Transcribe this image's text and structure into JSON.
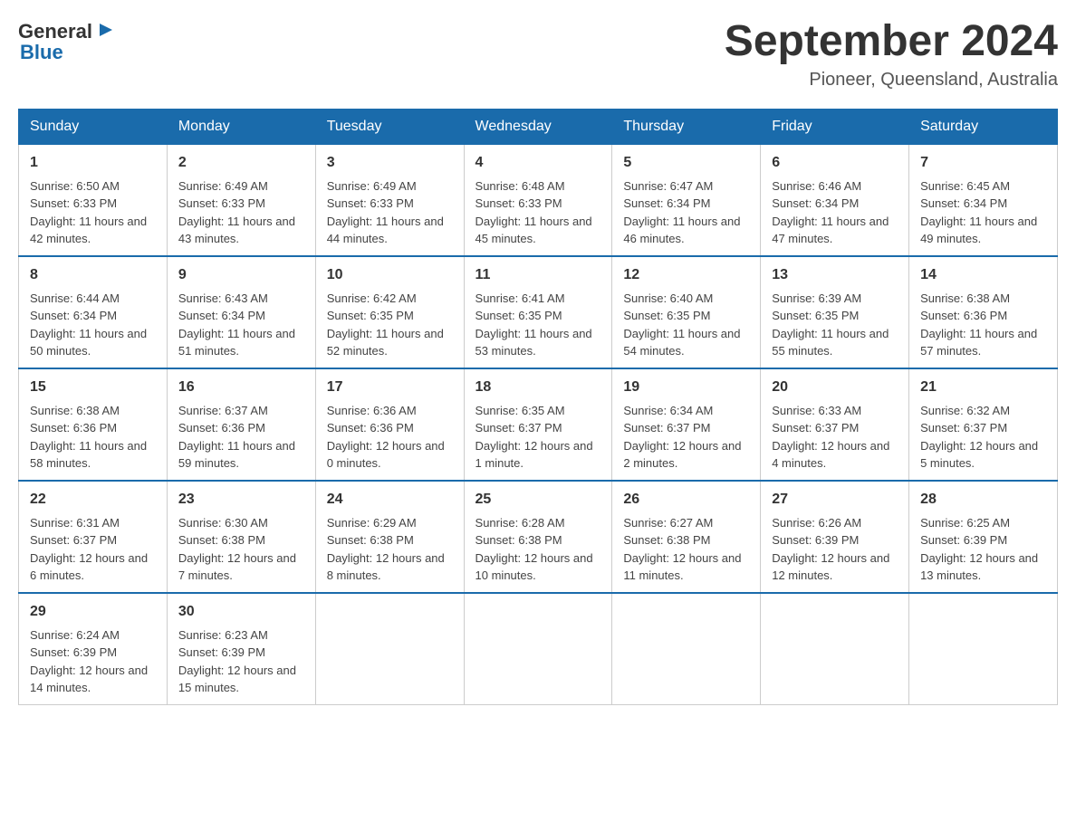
{
  "logo": {
    "general": "General",
    "blue": "Blue"
  },
  "title": "September 2024",
  "subtitle": "Pioneer, Queensland, Australia",
  "weekdays": [
    "Sunday",
    "Monday",
    "Tuesday",
    "Wednesday",
    "Thursday",
    "Friday",
    "Saturday"
  ],
  "weeks": [
    [
      {
        "day": "1",
        "sunrise": "6:50 AM",
        "sunset": "6:33 PM",
        "daylight": "11 hours and 42 minutes."
      },
      {
        "day": "2",
        "sunrise": "6:49 AM",
        "sunset": "6:33 PM",
        "daylight": "11 hours and 43 minutes."
      },
      {
        "day": "3",
        "sunrise": "6:49 AM",
        "sunset": "6:33 PM",
        "daylight": "11 hours and 44 minutes."
      },
      {
        "day": "4",
        "sunrise": "6:48 AM",
        "sunset": "6:33 PM",
        "daylight": "11 hours and 45 minutes."
      },
      {
        "day": "5",
        "sunrise": "6:47 AM",
        "sunset": "6:34 PM",
        "daylight": "11 hours and 46 minutes."
      },
      {
        "day": "6",
        "sunrise": "6:46 AM",
        "sunset": "6:34 PM",
        "daylight": "11 hours and 47 minutes."
      },
      {
        "day": "7",
        "sunrise": "6:45 AM",
        "sunset": "6:34 PM",
        "daylight": "11 hours and 49 minutes."
      }
    ],
    [
      {
        "day": "8",
        "sunrise": "6:44 AM",
        "sunset": "6:34 PM",
        "daylight": "11 hours and 50 minutes."
      },
      {
        "day": "9",
        "sunrise": "6:43 AM",
        "sunset": "6:34 PM",
        "daylight": "11 hours and 51 minutes."
      },
      {
        "day": "10",
        "sunrise": "6:42 AM",
        "sunset": "6:35 PM",
        "daylight": "11 hours and 52 minutes."
      },
      {
        "day": "11",
        "sunrise": "6:41 AM",
        "sunset": "6:35 PM",
        "daylight": "11 hours and 53 minutes."
      },
      {
        "day": "12",
        "sunrise": "6:40 AM",
        "sunset": "6:35 PM",
        "daylight": "11 hours and 54 minutes."
      },
      {
        "day": "13",
        "sunrise": "6:39 AM",
        "sunset": "6:35 PM",
        "daylight": "11 hours and 55 minutes."
      },
      {
        "day": "14",
        "sunrise": "6:38 AM",
        "sunset": "6:36 PM",
        "daylight": "11 hours and 57 minutes."
      }
    ],
    [
      {
        "day": "15",
        "sunrise": "6:38 AM",
        "sunset": "6:36 PM",
        "daylight": "11 hours and 58 minutes."
      },
      {
        "day": "16",
        "sunrise": "6:37 AM",
        "sunset": "6:36 PM",
        "daylight": "11 hours and 59 minutes."
      },
      {
        "day": "17",
        "sunrise": "6:36 AM",
        "sunset": "6:36 PM",
        "daylight": "12 hours and 0 minutes."
      },
      {
        "day": "18",
        "sunrise": "6:35 AM",
        "sunset": "6:37 PM",
        "daylight": "12 hours and 1 minute."
      },
      {
        "day": "19",
        "sunrise": "6:34 AM",
        "sunset": "6:37 PM",
        "daylight": "12 hours and 2 minutes."
      },
      {
        "day": "20",
        "sunrise": "6:33 AM",
        "sunset": "6:37 PM",
        "daylight": "12 hours and 4 minutes."
      },
      {
        "day": "21",
        "sunrise": "6:32 AM",
        "sunset": "6:37 PM",
        "daylight": "12 hours and 5 minutes."
      }
    ],
    [
      {
        "day": "22",
        "sunrise": "6:31 AM",
        "sunset": "6:37 PM",
        "daylight": "12 hours and 6 minutes."
      },
      {
        "day": "23",
        "sunrise": "6:30 AM",
        "sunset": "6:38 PM",
        "daylight": "12 hours and 7 minutes."
      },
      {
        "day": "24",
        "sunrise": "6:29 AM",
        "sunset": "6:38 PM",
        "daylight": "12 hours and 8 minutes."
      },
      {
        "day": "25",
        "sunrise": "6:28 AM",
        "sunset": "6:38 PM",
        "daylight": "12 hours and 10 minutes."
      },
      {
        "day": "26",
        "sunrise": "6:27 AM",
        "sunset": "6:38 PM",
        "daylight": "12 hours and 11 minutes."
      },
      {
        "day": "27",
        "sunrise": "6:26 AM",
        "sunset": "6:39 PM",
        "daylight": "12 hours and 12 minutes."
      },
      {
        "day": "28",
        "sunrise": "6:25 AM",
        "sunset": "6:39 PM",
        "daylight": "12 hours and 13 minutes."
      }
    ],
    [
      {
        "day": "29",
        "sunrise": "6:24 AM",
        "sunset": "6:39 PM",
        "daylight": "12 hours and 14 minutes."
      },
      {
        "day": "30",
        "sunrise": "6:23 AM",
        "sunset": "6:39 PM",
        "daylight": "12 hours and 15 minutes."
      },
      null,
      null,
      null,
      null,
      null
    ]
  ]
}
